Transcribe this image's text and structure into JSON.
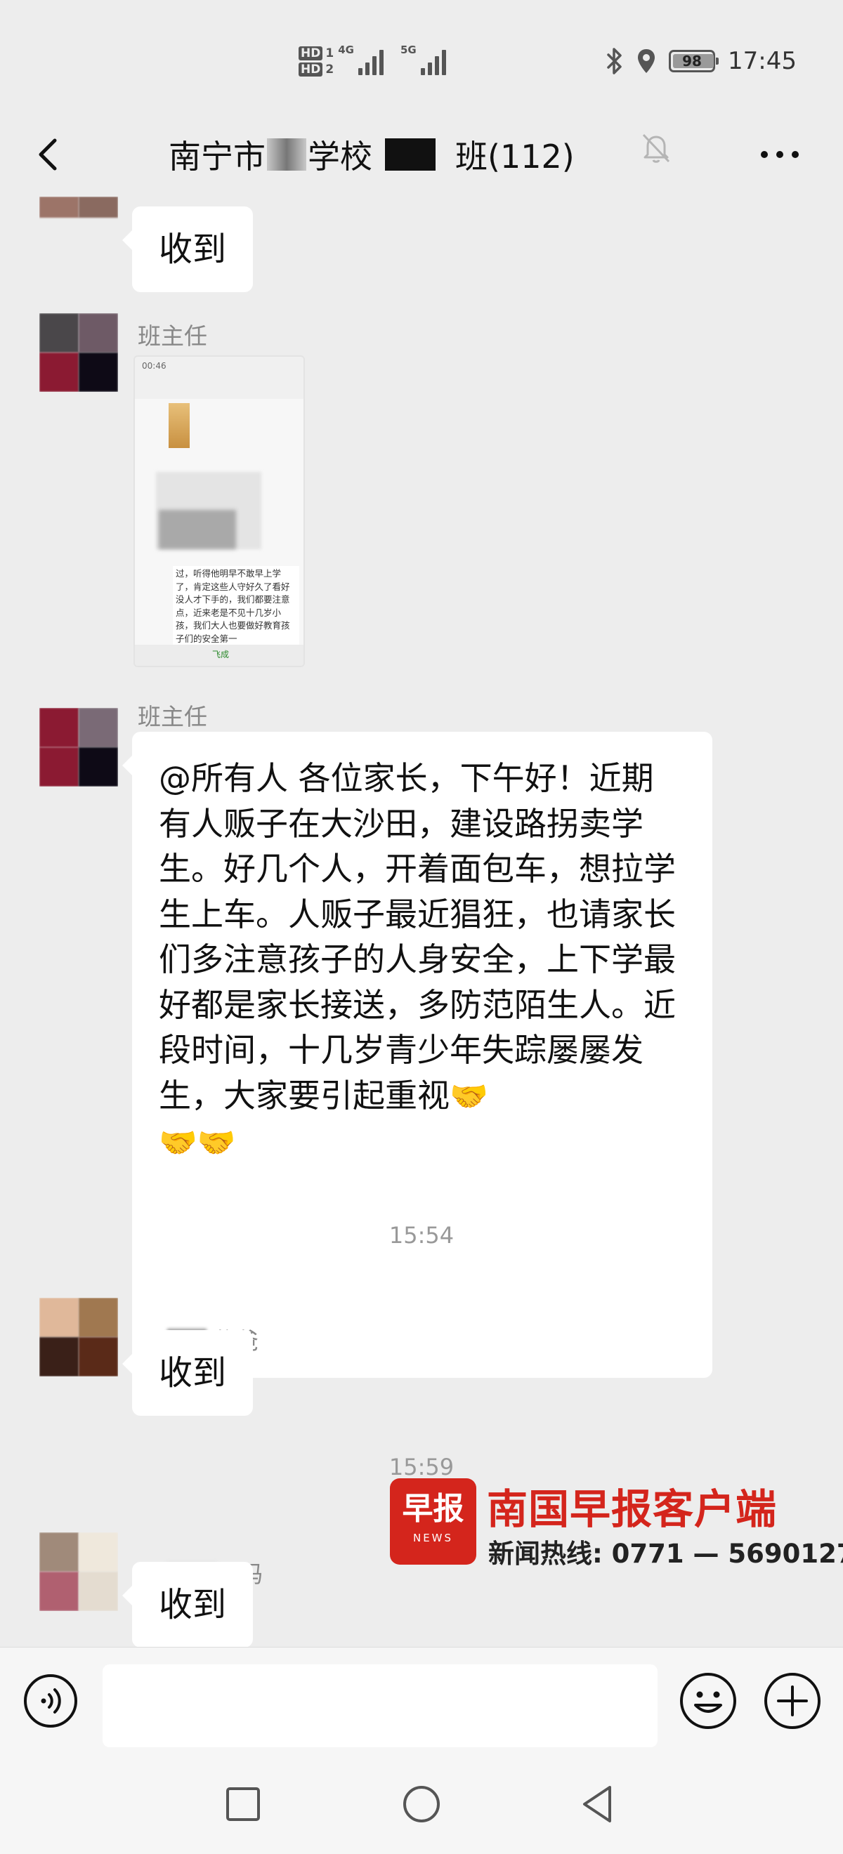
{
  "status_bar": {
    "hd1": "HD",
    "hd1_num": "1",
    "hd2": "HD",
    "hd2_num": "2",
    "net1": "4G",
    "net2": "5G",
    "battery": "98",
    "time": "17:45",
    "icons": [
      "bluetooth-icon",
      "location-icon",
      "battery-icon"
    ]
  },
  "nav": {
    "back_icon": "chevron-left-icon",
    "title_part1": "南宁市",
    "title_part2": "学校",
    "title_part3": "班(112)",
    "mute_icon": "bell-muted-icon",
    "more_icon": "more-dots-icon"
  },
  "messages": [
    {
      "type": "text",
      "sender": "",
      "text": "收到"
    },
    {
      "type": "image",
      "sender": "班主任",
      "thumb_time": "00:46",
      "thumb_text": "过，听得他明早不敢早上学了，肯定这些人守好久了看好没人才下手的，我们都要注意点，近来老是不见十几岁小孩，我们大人也要做好教育孩子们的安全第一",
      "thumb_footer": "飞成"
    },
    {
      "type": "text",
      "sender": "班主任",
      "text": "@所有人  各位家长，下午好！近期有人贩子在大沙田，建设路拐卖学生。好几个人，开着面包车，想拉学生上车。人贩子最近猖狂，也请家长们多注意孩子的人身安全，上下学最好都是家长接送，多防范陌生人。近段时间，十几岁青少年失踪屡屡发生，大家要引起重视",
      "emoji": "🤝",
      "emoji_line2": "🤝🤝"
    },
    {
      "type": "timestamp",
      "text": "15:54"
    },
    {
      "type": "text",
      "sender": "爸爸",
      "text": "收到"
    },
    {
      "type": "timestamp",
      "text": "15:59"
    },
    {
      "type": "text",
      "sender": "妈妈",
      "text": "收到"
    }
  ],
  "watermark": {
    "logo": "早报",
    "logo_sub": "NEWS",
    "title": "南国早报客户端",
    "hotline": "新闻热线: 0771 — 5690127",
    "brand_color": "#d4251c"
  },
  "input_bar": {
    "voice_icon": "voice-icon",
    "emoji_icon": "emoji-icon",
    "plus_icon": "plus-icon",
    "placeholder": ""
  },
  "system_nav": [
    "recent-apps-icon",
    "home-icon",
    "back-icon"
  ]
}
